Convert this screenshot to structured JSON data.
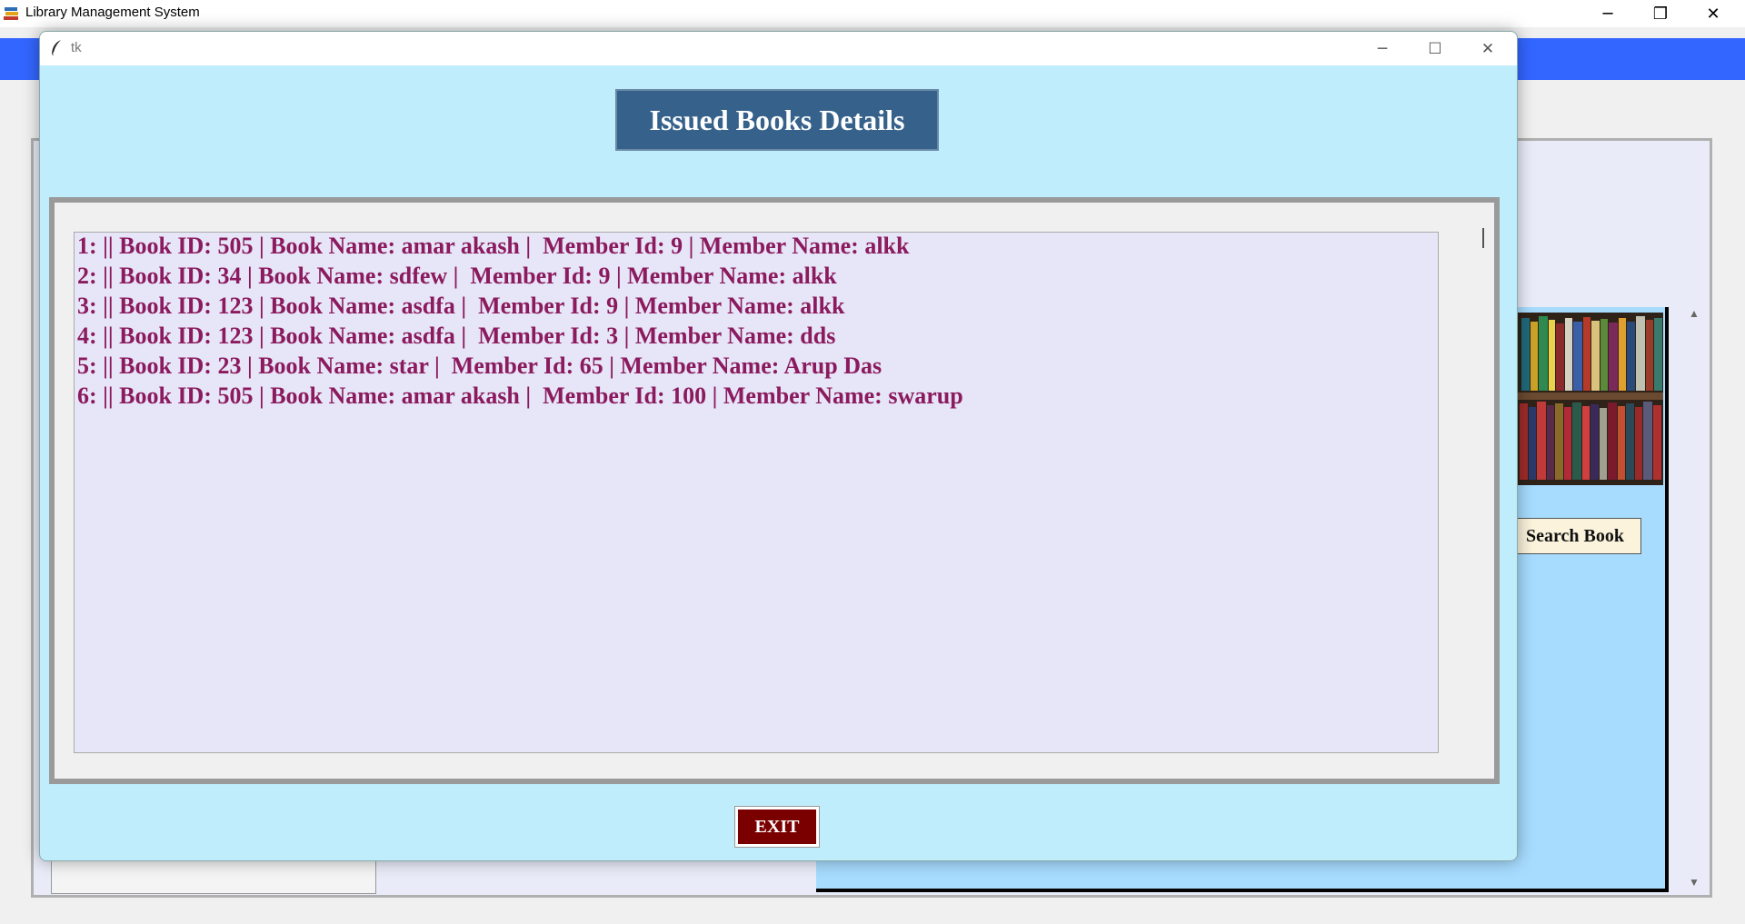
{
  "main_window": {
    "title": "Library Management System",
    "minimize_glyph": "─",
    "restore_glyph": "❐",
    "close_glyph": "✕",
    "search_book_label": "Search Book",
    "scroll_up_glyph": "▲",
    "scroll_down_glyph": "▼"
  },
  "popup": {
    "title": "tk",
    "minimize_glyph": "─",
    "maximize_glyph": "☐",
    "close_glyph": "✕",
    "heading": "Issued Books Details",
    "exit_label": "EXIT",
    "rows": [
      "1: || Book ID: 505 | Book Name: amar akash |  Member Id: 9 | Member Name: alkk",
      "2: || Book ID: 34 | Book Name: sdfew |  Member Id: 9 | Member Name: alkk",
      "3: || Book ID: 123 | Book Name: asdfa |  Member Id: 9 | Member Name: alkk",
      "4: || Book ID: 123 | Book Name: asdfa |  Member Id: 3 | Member Name: dds",
      "5: || Book ID: 23 | Book Name: star |  Member Id: 65 | Member Name: Arup Das",
      "6: || Book ID: 505 | Book Name: amar akash |  Member Id: 100 | Member Name: swarup"
    ]
  },
  "colors": {
    "popup_background": "#c0edfc",
    "heading_background": "#35618a",
    "row_text": "#8b1a5e",
    "exit_background": "#7a0000",
    "main_accent": "#3366ff"
  },
  "icons": {
    "app_icon": "books-icon",
    "popup_icon": "feather-icon"
  }
}
